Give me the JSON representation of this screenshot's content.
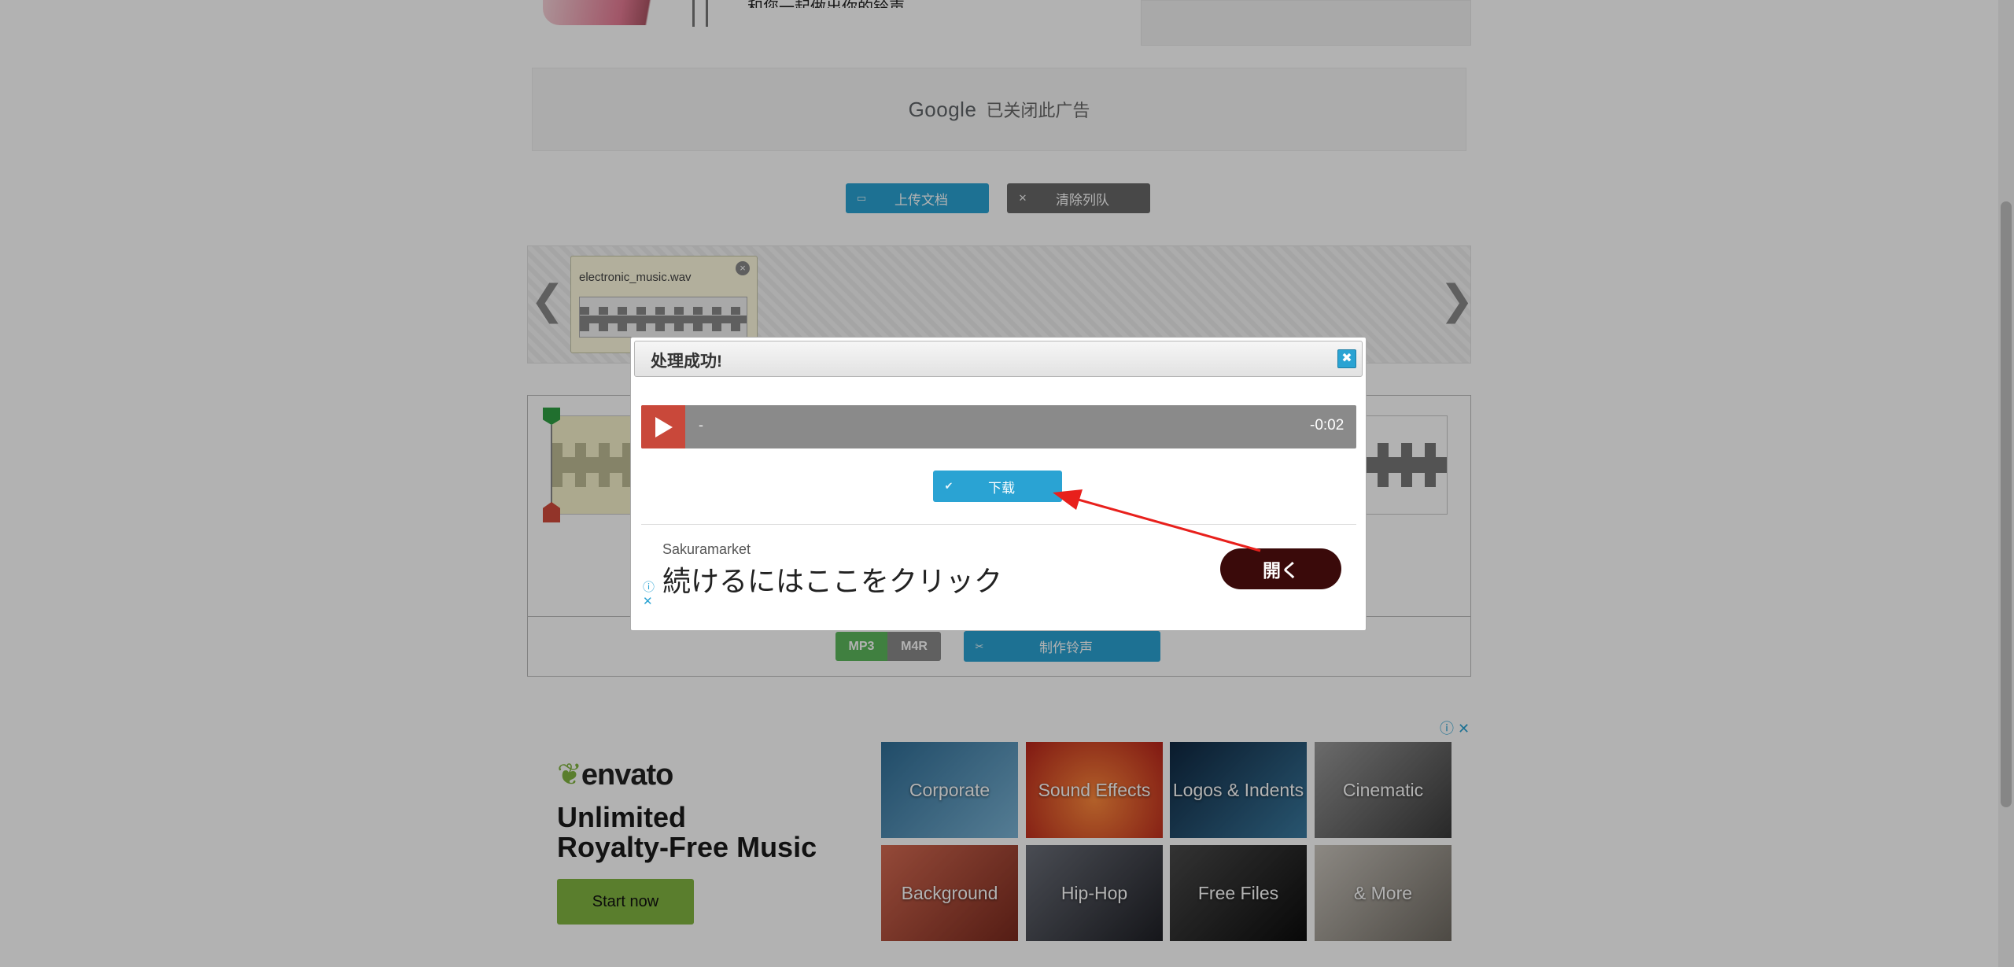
{
  "top": {
    "card_text": "和您一起做出你的铃声"
  },
  "google_ad": {
    "brand": "Google",
    "text": "已关闭此广告"
  },
  "toolbar": {
    "upload_label": "上传文档",
    "upload_icon": "folder-open-icon",
    "clear_label": "清除列队",
    "clear_icon": "close-icon"
  },
  "queue": {
    "prev": "❮",
    "next": "❯",
    "file_name": "electronic_music.wav",
    "close": "×"
  },
  "format": {
    "mp3": "MP3",
    "m4r": "M4R"
  },
  "make_button": {
    "label": "制作铃声",
    "icon": "scissors-icon"
  },
  "modal": {
    "title": "处理成功!",
    "close": "✖",
    "player": {
      "track": "-",
      "time": "-0:02"
    },
    "download_label": "下载",
    "download_icon": "check-icon"
  },
  "modal_ad": {
    "brand": "Sakuramarket",
    "text": "続けるにはここをクリック",
    "open": "開く",
    "info": "ⓘ",
    "close": "✕"
  },
  "envato_ad": {
    "info": "ⓘ",
    "close": "✕",
    "logo": "envato",
    "headline_1": "Unlimited",
    "headline_2": "Royalty-Free Music",
    "start": "Start now",
    "tiles": [
      {
        "label": "Corporate",
        "color": "#3c7ea6"
      },
      {
        "label": "Sound Effects",
        "color": "#d8481f"
      },
      {
        "label": "Logos & Indents",
        "color": "#1a3a5a"
      },
      {
        "label": "Cinematic",
        "color": "#6d6d6d"
      },
      {
        "label": "Background",
        "color": "#b0503a"
      },
      {
        "label": "Hip-Hop",
        "color": "#4a4a52"
      },
      {
        "label": "Free Files",
        "color": "#2a2a2a"
      },
      {
        "label": "& More",
        "color": "#9a9690"
      }
    ]
  },
  "colors": {
    "accent": "#2aa3d3",
    "play": "#c9483a",
    "mp3": "#5cb85c",
    "envato_green": "#82b541"
  }
}
